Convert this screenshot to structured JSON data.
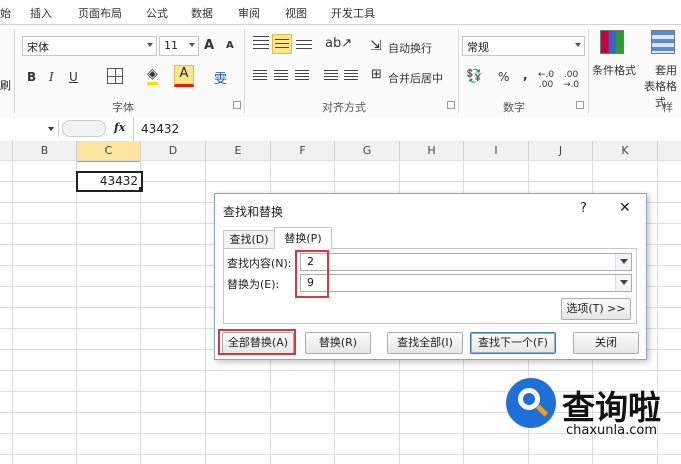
{
  "ribbon_tabs": [
    "始",
    "插入",
    "页面布局",
    "公式",
    "数据",
    "审阅",
    "视图",
    "开发工具"
  ],
  "font": {
    "name": "宋体",
    "size": "11",
    "grow": "A",
    "shrink": "A",
    "bold": "B",
    "italic": "I",
    "underline": "U",
    "group_label": "字体"
  },
  "alignment": {
    "wrap_text": "自动换行",
    "merge_center": "合并后居中",
    "group_label": "对齐方式"
  },
  "number": {
    "format": "常规",
    "percent": "%",
    "comma": ",",
    "group_label": "数字"
  },
  "styles": {
    "conditional_format": "条件格式",
    "table_format_1": "套用",
    "table_format_2": "表格格式",
    "group_label": "样式"
  },
  "ribbon_left_fragment": "刷",
  "formula_bar": {
    "fx": "fx",
    "value": "43432"
  },
  "columns": [
    "B",
    "C",
    "D",
    "E",
    "F",
    "G",
    "H",
    "I",
    "J",
    "K"
  ],
  "cell_c": {
    "value": "43432"
  },
  "dialog": {
    "title": "查找和替换",
    "help": "?",
    "close": "✕",
    "tab_find": "查找(D)",
    "tab_replace": "替换(P)",
    "find_label": "查找内容(N):",
    "find_value": "2",
    "replace_label": "替换为(E):",
    "replace_value": "9",
    "options_button": "选项(T) >>",
    "replace_all": "全部替换(A)",
    "replace": "替换(R)",
    "find_all": "查找全部(I)",
    "find_next": "查找下一个(F)",
    "close_button": "关闭"
  },
  "watermark": {
    "brand": "查询啦",
    "site": "chaxunla.com"
  },
  "colors": {
    "accent_red": "#d9363e",
    "tab_blue": "#2a5ea8",
    "watermark_blue": "#1e6fd9"
  }
}
